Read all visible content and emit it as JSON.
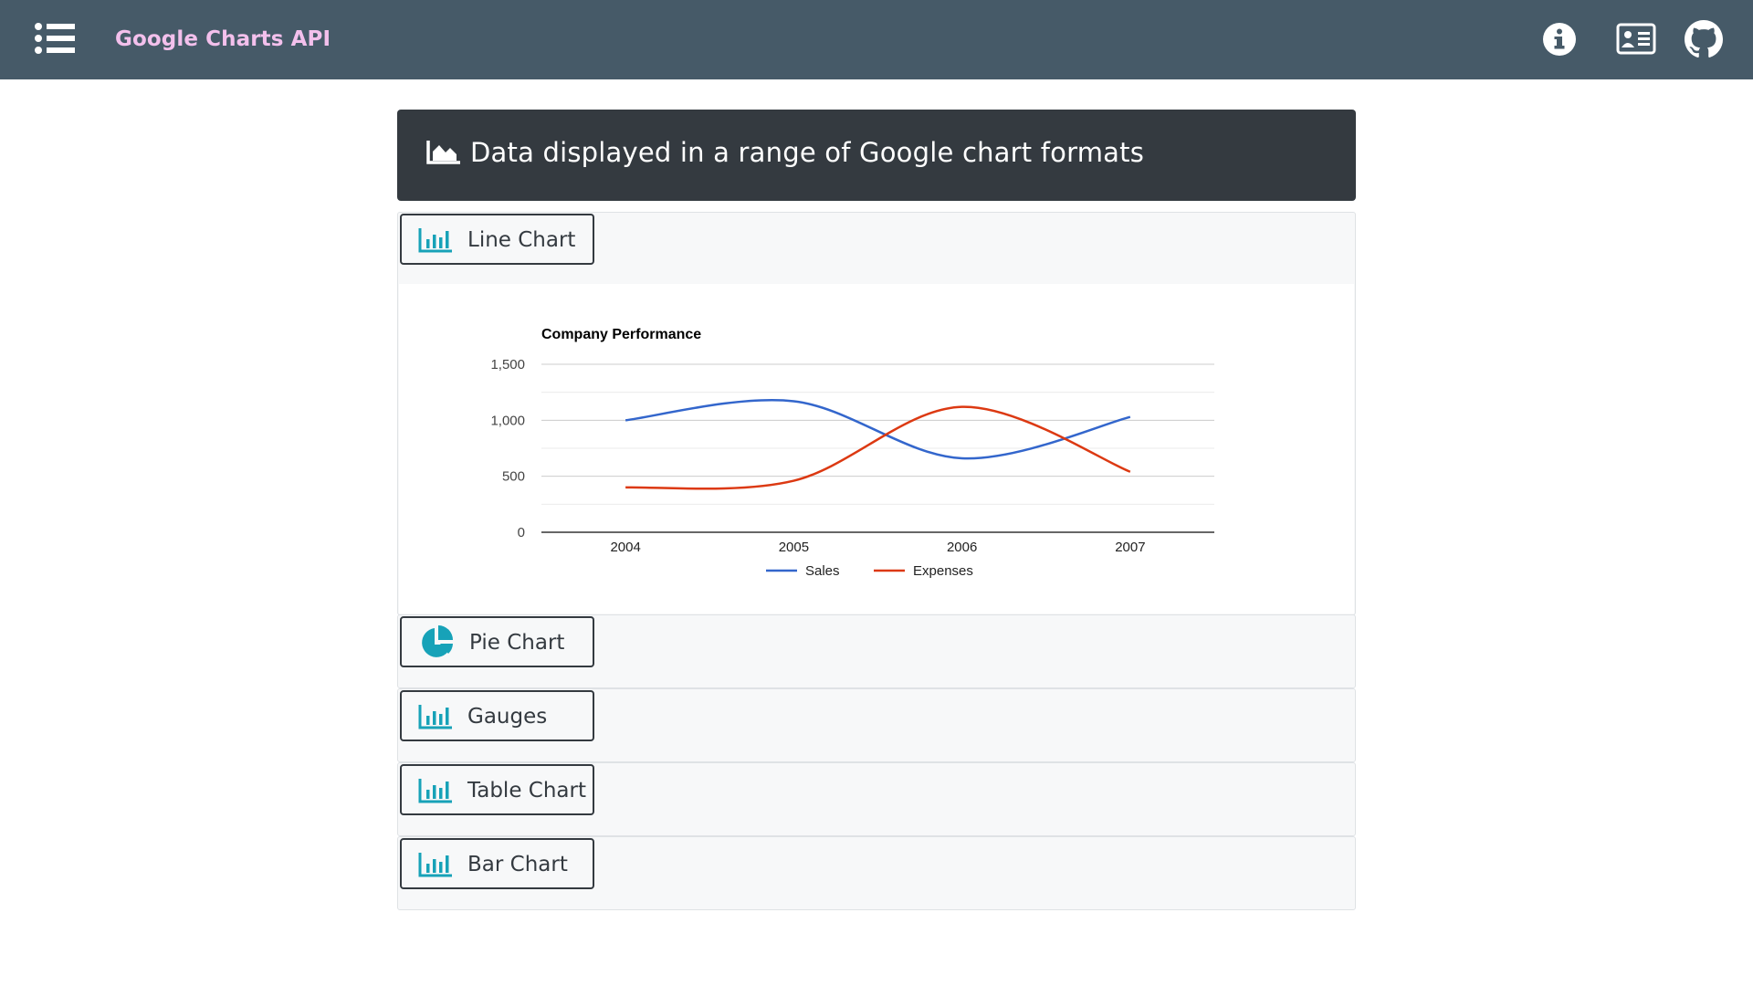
{
  "navbar": {
    "brand": "Google Charts API",
    "icons": [
      "list-icon",
      "info-icon",
      "contact-card-icon",
      "github-icon"
    ],
    "brand_color": "#f3c0ec",
    "background": "#465a68"
  },
  "header": {
    "title": "Data displayed in a range of Google chart formats",
    "icon": "area-chart-icon"
  },
  "accordion": [
    {
      "label": "Line Chart",
      "icon": "bar-chart-icon",
      "expanded": true
    },
    {
      "label": "Pie Chart",
      "icon": "pie-chart-icon",
      "expanded": false
    },
    {
      "label": "Gauges",
      "icon": "bar-chart-icon",
      "expanded": false
    },
    {
      "label": "Table Chart",
      "icon": "bar-chart-icon",
      "expanded": false
    },
    {
      "label": "Bar Chart",
      "icon": "bar-chart-icon",
      "expanded": false
    }
  ],
  "chart_data": {
    "type": "line",
    "title": "Company Performance",
    "x": [
      "2004",
      "2005",
      "2006",
      "2007"
    ],
    "series": [
      {
        "name": "Sales",
        "values": [
          1000,
          1170,
          660,
          1030
        ],
        "color": "#3366cc"
      },
      {
        "name": "Expenses",
        "values": [
          400,
          460,
          1120,
          540
        ],
        "color": "#dc3912"
      }
    ],
    "yticks": [
      "0",
      "500",
      "1,000",
      "1,500"
    ],
    "ylim": [
      0,
      1500
    ],
    "grid": true,
    "legend": "bottom",
    "curve": "smooth"
  }
}
